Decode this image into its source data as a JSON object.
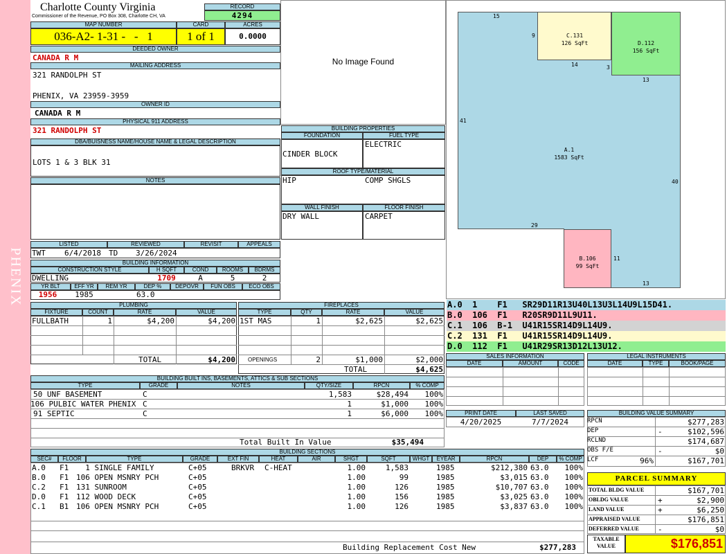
{
  "sidebar": {
    "text": "PHENIX"
  },
  "header": {
    "county": "Charlotte County Virginia",
    "commissioner": "Commissioner of the Revenue, PO Box 308, Charlotte CH, VA",
    "record_label": "RECORD",
    "record": "4294"
  },
  "parcel": {
    "map_number_label": "MAP NUMBER",
    "map_number": "036-A2- 1-31 -   -   1",
    "card_label": "CARD",
    "card": "1 of 1",
    "acres_label": "ACRES",
    "acres": "0.0000"
  },
  "owner": {
    "deeded_label": "DEEDED OWNER",
    "deeded": "CANADA R M",
    "mailing_label": "MAILING ADDRESS",
    "mailing_line1": "321 RANDOLPH ST",
    "mailing_line2": "PHENIX, VA 23959-3959",
    "owner_id_label": "OWNER ID",
    "owner_id": "CANADA R M",
    "physical_label": "PHYSICAL 911 ADDRESS",
    "physical": "321 RANDOLPH ST"
  },
  "legal": {
    "label": "DBA/BUISNESS NAME/HOUSE NAME & LEGAL DESCRIPTION",
    "text": "LOTS 1 & 3 BLK 31"
  },
  "notes": {
    "label": "NOTES"
  },
  "photo": {
    "text": "No Image Found"
  },
  "props": {
    "title": "BUILDING PROPERTIES",
    "foundation_label": "FOUNDATION",
    "foundation": "CINDER BLOCK",
    "fuel_label": "FUEL TYPE",
    "fuel": "ELECTRIC",
    "roof_label": "ROOF TYPE/MATERIAL",
    "roof_type": "HIP",
    "roof_material": "COMP SHGLS",
    "wall_label": "WALL FINISH",
    "wall": "DRY WALL",
    "floor_label": "FLOOR FINISH",
    "floor": "CARPET"
  },
  "review": {
    "listed_label": "LISTED",
    "listed_by": "TWT",
    "listed_date": "6/4/2018",
    "reviewed_label": "REVIEWED",
    "reviewed_by": "TD",
    "reviewed_date": "3/26/2024",
    "revisit_label": "REVISIT",
    "appeals_label": "APPEALS"
  },
  "building": {
    "title": "BUILDING INFORMATION",
    "style_label": "CONSTRUCTION STYLE",
    "style": "DWELLING",
    "hsqft_label": "H SQFT",
    "hsqft": "1709",
    "cond_label": "COND",
    "cond": "A",
    "rooms_label": "ROOMS",
    "rooms": "5",
    "bdrms_label": "BDRMS",
    "bdrms": "2",
    "yrblt_label": "YR BLT",
    "yrblt": "1956",
    "effyr_label": "EFF YR",
    "effyr": "1985",
    "remyr_label": "REM YR",
    "dep_label": "DEP %",
    "dep": "63.0",
    "depovr_label": "DEPOVR",
    "funobs_label": "FUN OBS",
    "ecoobs_label": "ECO OBS"
  },
  "plumbing": {
    "title": "PLUMBING",
    "h_fixture": "FIXTURE",
    "h_count": "COUNT",
    "h_rate": "RATE",
    "h_value": "VALUE",
    "fixture": "FULLBATH",
    "count": "1",
    "rate": "$4,200",
    "value": "$4,200",
    "total_label": "TOTAL",
    "total": "$4,200"
  },
  "fireplaces": {
    "title": "FIREPLACES",
    "h_type": "TYPE",
    "h_qty": "QTY",
    "h_rate": "RATE",
    "h_value": "VALUE",
    "type": "1ST MAS",
    "qty": "1",
    "rate": "$2,625",
    "value": "$2,625",
    "openings_label": "OPENINGS",
    "openings_qty": "2",
    "openings_rate": "$1,000",
    "openings_value": "$2,000",
    "total_label": "TOTAL",
    "total": "$4,625"
  },
  "builtins": {
    "title": "BUILDING BUILT INS, BASEMENTS, ATTICS & SUB SECTIONS",
    "h_type": "TYPE",
    "h_grade": "GRADE",
    "h_notes": "NOTES",
    "h_qty": "QTY/SIZE",
    "h_rpcn": "RPCN",
    "h_comp": "% COMP",
    "rows": [
      {
        "type": "50 UNF BASEMENT",
        "grade": "C",
        "qty": "1,583",
        "rpcn": "$28,494",
        "comp": "100%"
      },
      {
        "type": "106 PULBIC WATER PHENIX",
        "grade": "C",
        "qty": "1",
        "rpcn": "$1,000",
        "comp": "100%"
      },
      {
        "type": "91 SEPTIC",
        "grade": "C",
        "qty": "1",
        "rpcn": "$6,000",
        "comp": "100%"
      }
    ],
    "total_label": "Total Built In Value",
    "total": "$35,494"
  },
  "sections": {
    "title": "BUILDING SECTIONS",
    "headers": {
      "sec": "SEC#",
      "floor": "FLOOR",
      "type": "TYPE",
      "grade": "GRADE",
      "extfin": "EXT FIN",
      "heat": "HEAT",
      "air": "AIR",
      "shgt": "SHGT",
      "sqft": "SQFT",
      "whgt": "WHGT",
      "eyear": "EYEAR",
      "rpcn": "RPCN",
      "dep": "DEP",
      "comp": "% COMP"
    },
    "rows": [
      {
        "sec": "A.0",
        "floor": "F1",
        "type": "  1 SINGLE FAMILY",
        "grade": "C+05",
        "extfin": "BRKVR",
        "heat": "C-HEAT",
        "air": "",
        "shgt": "1.00",
        "sqft": "1,583",
        "eyear": "1985",
        "rpcn": "$212,380",
        "dep": "63.0",
        "comp": "100%"
      },
      {
        "sec": "B.0",
        "floor": "F1",
        "type": "106 OPEN MSNRY PCH",
        "grade": "C+05",
        "extfin": "",
        "heat": "",
        "air": "",
        "shgt": "1.00",
        "sqft": "99",
        "eyear": "1985",
        "rpcn": "$3,015",
        "dep": "63.0",
        "comp": "100%"
      },
      {
        "sec": "C.2",
        "floor": "F1",
        "type": "131 SUNROOM",
        "grade": "C+05",
        "extfin": "",
        "heat": "",
        "air": "",
        "shgt": "1.00",
        "sqft": "126",
        "eyear": "1985",
        "rpcn": "$10,707",
        "dep": "63.0",
        "comp": "100%"
      },
      {
        "sec": "D.0",
        "floor": "F1",
        "type": "112 WOOD DECK",
        "grade": "C+05",
        "extfin": "",
        "heat": "",
        "air": "",
        "shgt": "1.00",
        "sqft": "156",
        "eyear": "1985",
        "rpcn": "$3,025",
        "dep": "63.0",
        "comp": "100%"
      },
      {
        "sec": "C.1",
        "floor": "B1",
        "type": "106 OPEN MSNRY PCH",
        "grade": "C+05",
        "extfin": "",
        "heat": "",
        "air": "",
        "shgt": "1.00",
        "sqft": "126",
        "eyear": "1985",
        "rpcn": "$3,837",
        "dep": "63.0",
        "comp": "100%"
      }
    ],
    "total_label": "Building Replacement Cost New",
    "total": "$277,283"
  },
  "sketch": {
    "areas": [
      {
        "id": "A.1",
        "sqft": "1583 SqFt",
        "color": "#add8e6"
      },
      {
        "id": "B.106",
        "sqft": "99 SqFt",
        "color": "#ffb6c1"
      },
      {
        "id": "C.131",
        "sqft": "126 SqFt",
        "color": "#fffacd"
      },
      {
        "id": "D.112",
        "sqft": "156 SqFt",
        "color": "#90ee90"
      }
    ],
    "dims": [
      "15",
      "9",
      "14",
      "3",
      "13",
      "41",
      "40",
      "29",
      "11",
      "13"
    ],
    "segments": [
      {
        "text": "A.0  1    F1   SR29D11R13U40L13U3L14U9L15D41.",
        "color": "#add8e6"
      },
      {
        "text": "B.0  106  F1   R20SR9D11L9U11.",
        "color": "#ffb6c1"
      },
      {
        "text": "C.1  106  B-1  U41R15SR14D9L14U9.",
        "color": "#d3d3d3"
      },
      {
        "text": "C.2  131  F1   U41R15SR14D9L14U9.",
        "color": "#fffacd"
      },
      {
        "text": "D.0  112  F1   U41R29SR13D12L13U12.",
        "color": "#90ee90"
      }
    ]
  },
  "sales": {
    "title": "SALES INFORMATION",
    "h_date": "DATE",
    "h_amount": "AMOUNT",
    "h_code": "CODE"
  },
  "legal_instruments": {
    "title": "LEGAL INSTRUMENTS",
    "h_date": "DATE",
    "h_type": "TYPE",
    "h_bookpage": "BOOK/PAGE"
  },
  "dates": {
    "print_label": "PRINT DATE",
    "print": "4/20/2025",
    "saved_label": "LAST SAVED",
    "saved": "7/7/2024"
  },
  "value_summary": {
    "title": "BUILDING VALUE SUMMARY",
    "rpcn_label": "RPCN",
    "rpcn": "$277,283",
    "dep_label": "DEP",
    "dep_sign": "-",
    "dep": "$102,596",
    "rclnd_label": "RCLND",
    "rclnd": "$174,687",
    "obs_label": "OBS F/E",
    "obs_sign": "-",
    "obs": "$0",
    "lcf_label": "LCF",
    "lcf_pct": "96%",
    "lcf": "$167,701"
  },
  "parcel_summary": {
    "title": "PARCEL SUMMARY",
    "bldg_label": "TOTAL BLDG VALUE",
    "bldg": "$167,701",
    "obldg_label": "OBLDG VALUE",
    "obldg_sign": "+",
    "obldg": "$2,900",
    "land_label": "LAND VALUE",
    "land_sign": "+",
    "land": "$6,250",
    "appraised_label": "APPRAISED VALUE",
    "appraised": "$176,851",
    "deferred_label": "DEFERRED VALUE",
    "deferred_sign": "-",
    "deferred": "$0",
    "taxable_label1": "TAXABLE",
    "taxable_label2": "VALUE",
    "taxable": "$176,851"
  }
}
